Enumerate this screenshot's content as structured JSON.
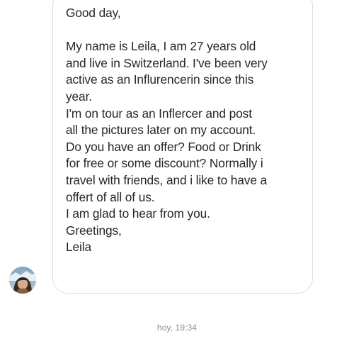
{
  "message": {
    "greeting": "Good day,",
    "paragraph_lines": [
      "My name is Leila, I am 27 years old",
      "and live in Switzerland. I've been very",
      "active as an Influrencerin since this",
      "year.",
      "I'm on tour as an Inflercer and post",
      "all the pictures later on my account.",
      "Do you have an offer? Food or Drink",
      "for free or some discount? Normally i",
      "travel with friends, and i like to have a",
      "offert of all of us.",
      "I am glad to hear from you.",
      "Greetings,",
      "Leila"
    ]
  },
  "sender": {
    "avatar_icon": "profile-photo"
  },
  "timestamp": "hoy, 19:34",
  "colors": {
    "bubble_border": "#dedede",
    "message_text": "#262626",
    "timestamp_text": "#8e8e8e",
    "background": "#ffffff"
  }
}
